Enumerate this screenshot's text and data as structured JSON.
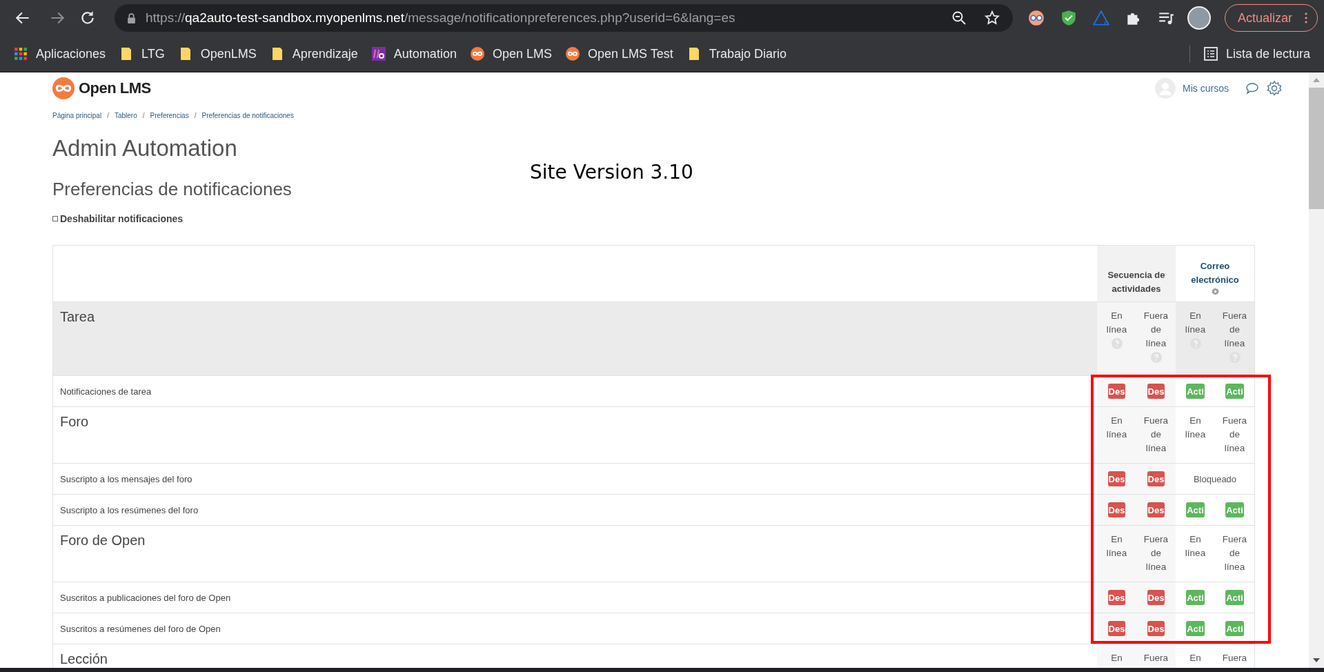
{
  "browser": {
    "url": {
      "scheme": "https://",
      "host": "qa2auto-test-sandbox.myopenlms.net",
      "path": "/message/notificationpreferences.php?userid=6&lang=es"
    },
    "update_button": "Actualizar",
    "bookmarks": [
      {
        "label": "Aplicaciones",
        "kind": "apps"
      },
      {
        "label": "LTG",
        "kind": "folder"
      },
      {
        "label": "OpenLMS",
        "kind": "folder"
      },
      {
        "label": "Aprendizaje",
        "kind": "folder"
      },
      {
        "label": "Automation",
        "kind": "lg"
      },
      {
        "label": "Open LMS",
        "kind": "openlms"
      },
      {
        "label": "Open LMS Test",
        "kind": "openlms"
      },
      {
        "label": "Trabajo Diario",
        "kind": "folder"
      }
    ],
    "reading_list": "Lista de lectura"
  },
  "header": {
    "logo": "Open LMS",
    "user_menu": "Mis cursos"
  },
  "breadcrumb_separator": "/",
  "breadcrumb": [
    "Página principal",
    "Tablero",
    "Preferencias",
    "Preferencias de notificaciones"
  ],
  "page_title": "Admin Automation",
  "annotation": "Site Version 3.10",
  "section_title": "Preferencias de notificaciones",
  "disable_checkbox": {
    "label": "Deshabilitar notificaciones",
    "checked": false
  },
  "table": {
    "processors": [
      {
        "name": "Secuencia de actividades",
        "configurable": false
      },
      {
        "name": "Correo electrónico",
        "configurable": true
      }
    ],
    "groups": [
      {
        "name": "Tarea",
        "shaded": true,
        "columns": [
          {
            "label": "En línea",
            "help": true
          },
          {
            "label": "Fuera de línea",
            "help": true
          },
          {
            "label": "En línea",
            "help": true
          },
          {
            "label": "Fuera de línea",
            "help": true
          }
        ],
        "items": [
          {
            "name": "Notificaciones de tarea",
            "cells": [
              {
                "kind": "toggle",
                "on": false,
                "label": "Des"
              },
              {
                "kind": "toggle",
                "on": false,
                "label": "Des"
              },
              {
                "kind": "toggle",
                "on": true,
                "label": "Acti"
              },
              {
                "kind": "toggle",
                "on": true,
                "label": "Acti"
              }
            ]
          }
        ]
      },
      {
        "name": "Foro",
        "shaded": false,
        "columns": [
          {
            "label": "En línea",
            "help": false
          },
          {
            "label": "Fuera de línea",
            "help": false
          },
          {
            "label": "En línea",
            "help": false
          },
          {
            "label": "Fuera de línea",
            "help": false
          }
        ],
        "items": [
          {
            "name": "Suscripto a los mensajes del foro",
            "cells": [
              {
                "kind": "toggle",
                "on": false,
                "label": "Des"
              },
              {
                "kind": "toggle",
                "on": false,
                "label": "Des"
              },
              {
                "kind": "blocked",
                "label": "Bloqueado"
              }
            ]
          },
          {
            "name": "Suscripto a los resúmenes del foro",
            "cells": [
              {
                "kind": "toggle",
                "on": false,
                "label": "Des"
              },
              {
                "kind": "toggle",
                "on": false,
                "label": "Des"
              },
              {
                "kind": "toggle",
                "on": true,
                "label": "Acti"
              },
              {
                "kind": "toggle",
                "on": true,
                "label": "Acti"
              }
            ]
          }
        ]
      },
      {
        "name": "Foro de Open",
        "shaded": false,
        "columns": [
          {
            "label": "En línea",
            "help": false
          },
          {
            "label": "Fuera de línea",
            "help": false
          },
          {
            "label": "En línea",
            "help": false
          },
          {
            "label": "Fuera de línea",
            "help": false
          }
        ],
        "items": [
          {
            "name": "Suscritos a publicaciones del foro de Open",
            "cells": [
              {
                "kind": "toggle",
                "on": false,
                "label": "Des"
              },
              {
                "kind": "toggle",
                "on": false,
                "label": "Des"
              },
              {
                "kind": "toggle",
                "on": true,
                "label": "Acti"
              },
              {
                "kind": "toggle",
                "on": true,
                "label": "Acti"
              }
            ]
          },
          {
            "name": "Suscritos a resúmenes del foro de Open",
            "cells": [
              {
                "kind": "toggle",
                "on": false,
                "label": "Des"
              },
              {
                "kind": "toggle",
                "on": false,
                "label": "Des"
              },
              {
                "kind": "toggle",
                "on": true,
                "label": "Acti"
              },
              {
                "kind": "toggle",
                "on": true,
                "label": "Acti"
              }
            ]
          }
        ]
      },
      {
        "name": "Lección",
        "shaded": false,
        "columns": [
          {
            "label": "En",
            "help": false
          },
          {
            "label": "Fuera",
            "help": false
          },
          {
            "label": "En",
            "help": false
          },
          {
            "label": "Fuera",
            "help": false
          }
        ]
      }
    ]
  }
}
